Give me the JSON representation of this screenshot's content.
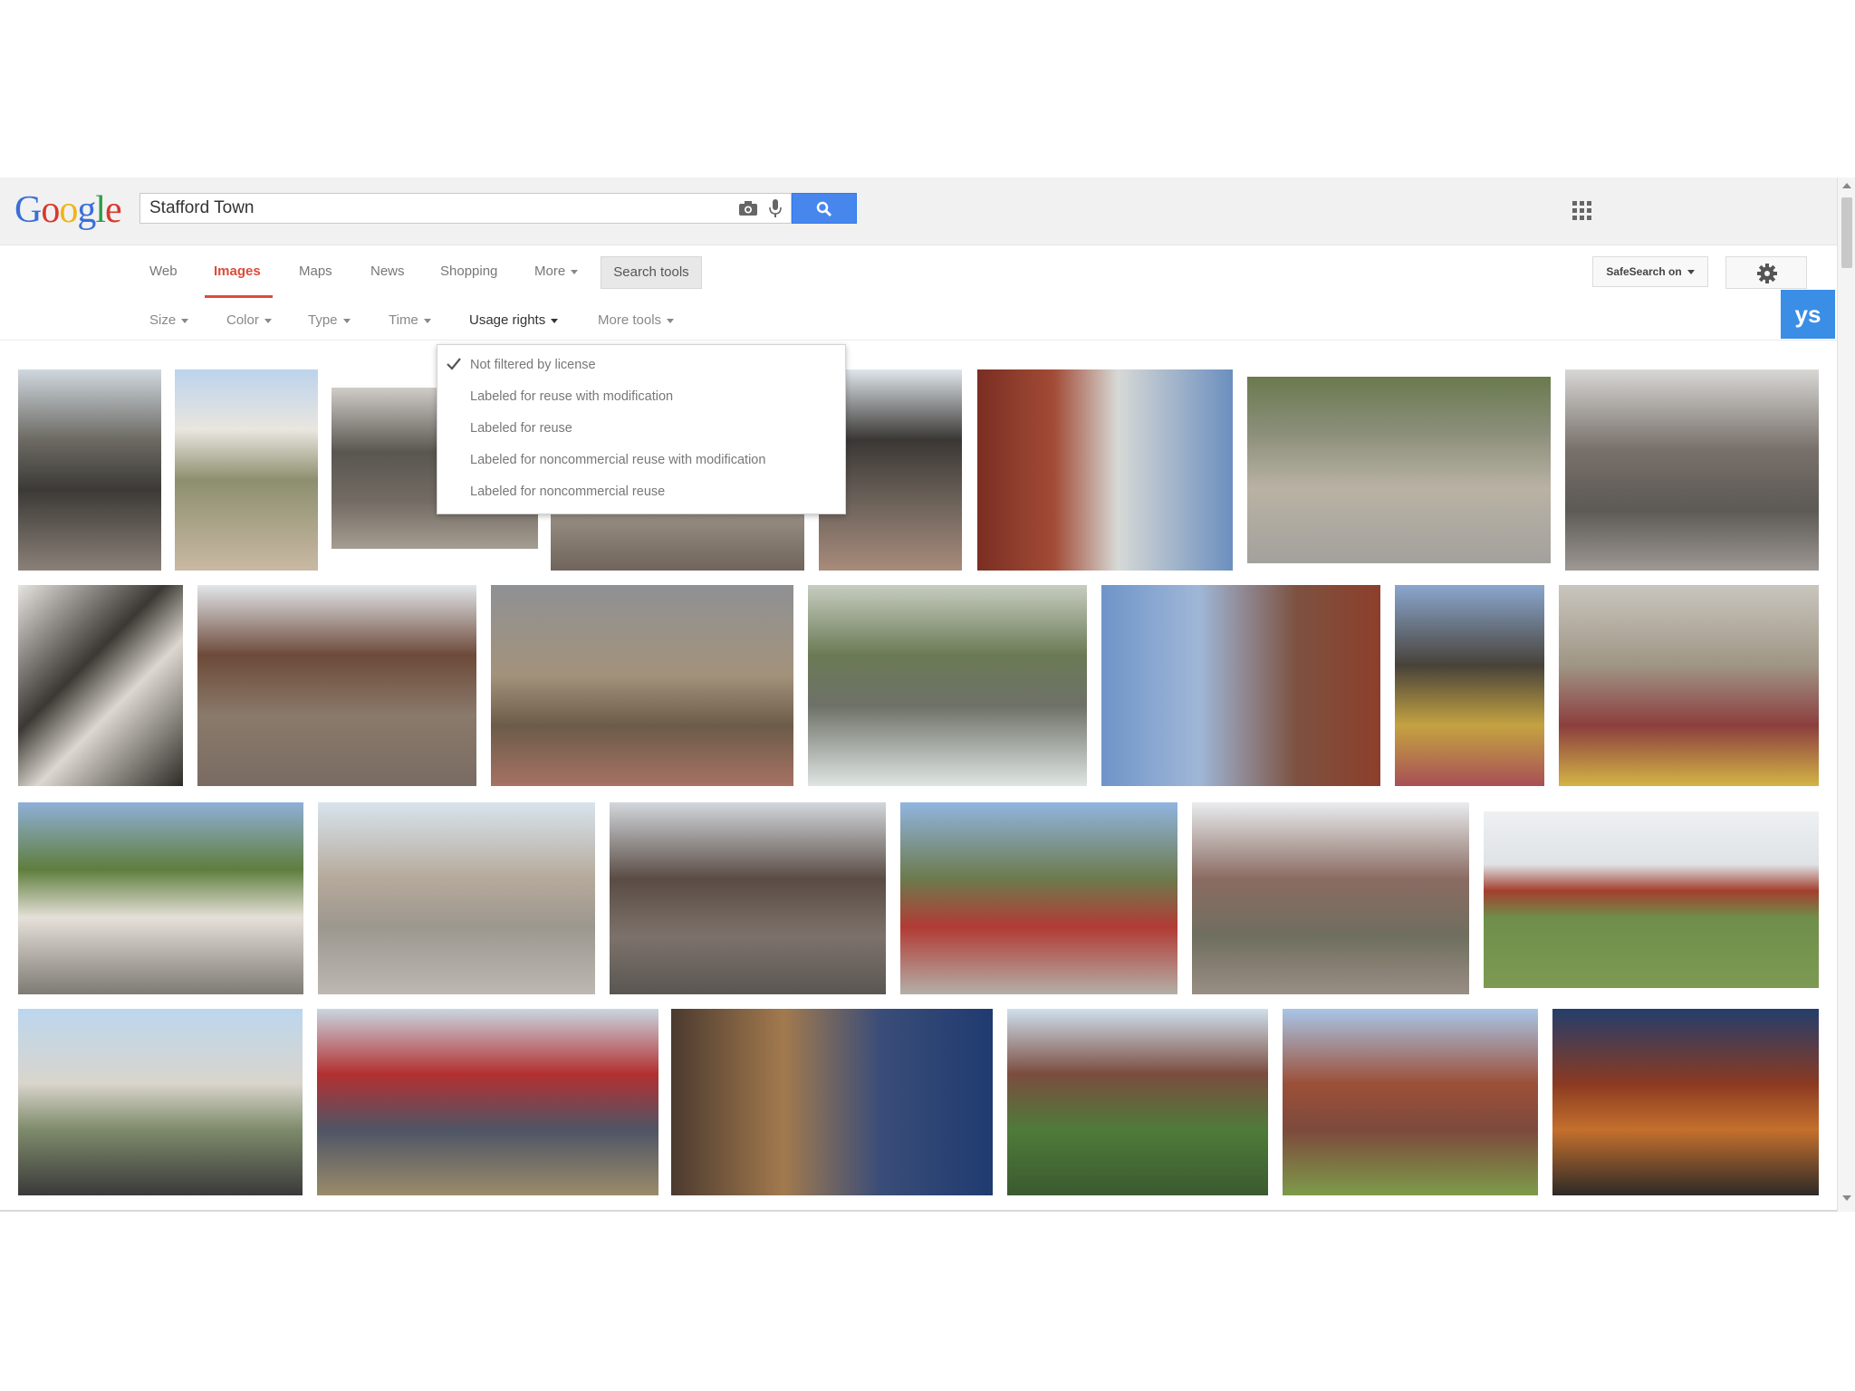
{
  "header": {
    "logo_text": "Google",
    "search_query": "Stafford Town",
    "icons": {
      "camera": "camera-icon",
      "mic": "mic-icon",
      "search": "search-icon",
      "apps": "apps-grid-icon"
    }
  },
  "nav": {
    "tabs": [
      {
        "label": "Web"
      },
      {
        "label": "Images",
        "active": true
      },
      {
        "label": "Maps"
      },
      {
        "label": "News"
      },
      {
        "label": "Shopping"
      },
      {
        "label": "More"
      }
    ],
    "search_tools_label": "Search tools",
    "safesearch_label": "SafeSearch on",
    "settings_icon": "gear-icon",
    "badge_text": "ys"
  },
  "tools": {
    "items": [
      {
        "label": "Size"
      },
      {
        "label": "Color"
      },
      {
        "label": "Type"
      },
      {
        "label": "Time"
      },
      {
        "label": "Usage rights",
        "active": true
      },
      {
        "label": "More tools"
      }
    ]
  },
  "usage_rights_menu": {
    "selected_index": 0,
    "options": [
      "Not filtered by license",
      "Labeled for reuse with modification",
      "Labeled for reuse",
      "Labeled for noncommercial reuse with modification",
      "Labeled for noncommercial reuse"
    ]
  },
  "colors": {
    "accent_red": "#dd4b39",
    "search_blue": "#4787ed",
    "badge_blue": "#3a8ee6",
    "header_bg": "#f1f1f1"
  }
}
